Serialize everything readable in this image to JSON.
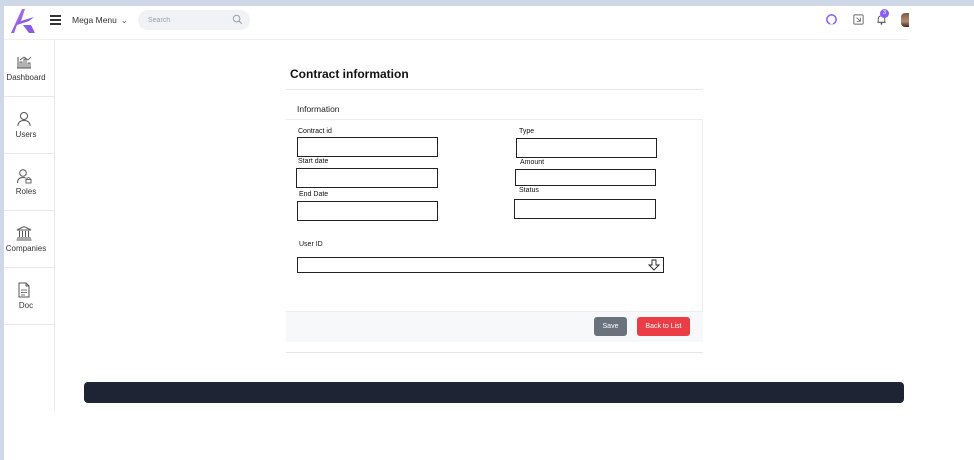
{
  "header": {
    "mega_menu": "Mega Menu",
    "search_placeholder": "Search",
    "notification_count": "3"
  },
  "sidebar": {
    "items": [
      {
        "label": "Dashboard",
        "icon": "chart-icon"
      },
      {
        "label": "Users",
        "icon": "user-icon"
      },
      {
        "label": "Roles",
        "icon": "user-lock-icon"
      },
      {
        "label": "Companies",
        "icon": "bank-icon"
      },
      {
        "label": "Doc",
        "icon": "document-icon"
      }
    ]
  },
  "page": {
    "title": "Contract information",
    "section": "Information",
    "fields": {
      "contract_id": {
        "label": "Contract id",
        "value": ""
      },
      "start_date": {
        "label": "Start date",
        "value": ""
      },
      "end_date": {
        "label": "End Date",
        "value": ""
      },
      "type": {
        "label": "Type",
        "value": ""
      },
      "amount": {
        "label": "Amount",
        "value": ""
      },
      "status": {
        "label": "Status",
        "value": ""
      },
      "user_id": {
        "label": "User ID",
        "value": ""
      }
    },
    "buttons": {
      "save": "Save",
      "back": "Back to List"
    }
  },
  "colors": {
    "accent": "#8a5cf6",
    "save_button": "#6a737d",
    "back_button": "#ea3d45",
    "footer_bar": "#1e2433"
  }
}
